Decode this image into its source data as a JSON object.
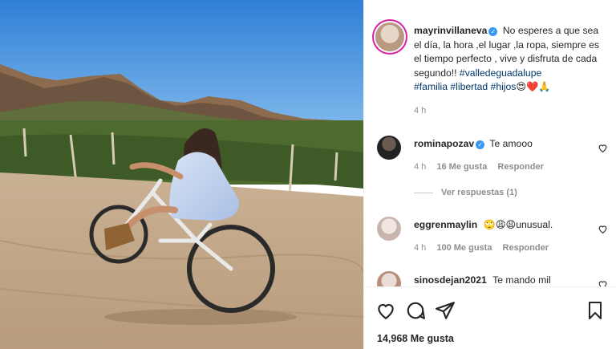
{
  "post": {
    "author": "mayrinvillaneva",
    "caption_text": "No esperes a que sea el día, la hora ,el lugar ,la ropa, siempre es el tiempo perfecto , vive y disfruta de cada segundo!! ",
    "hashtags": [
      "#valledeguadalupe",
      "#familia",
      "#libertad",
      "#hijos"
    ],
    "emojis": [
      "😍",
      "❤️",
      "🙏"
    ],
    "time": "4 h"
  },
  "comments": [
    {
      "user": "rominapozav",
      "verified": true,
      "text": "Te amooo",
      "time": "4 h",
      "likes": "16 Me gusta",
      "reply": "Responder",
      "replies_label": "Ver respuestas (1)"
    },
    {
      "user": "eggrenmaylin",
      "verified": false,
      "text": "🙄😩😩unusual.",
      "time": "4 h",
      "likes": "100 Me gusta",
      "reply": "Responder"
    },
    {
      "user": "sinosdejan2021",
      "verified": false,
      "text": "Te mando mil"
    }
  ],
  "footer": {
    "likes": "14,968 Me gusta"
  },
  "colors": {
    "verified": "#3897f0",
    "hashtag": "#00376b",
    "meta": "#8e8e8e",
    "heart": "#ed4956"
  },
  "icons": [
    "heart-icon",
    "comment-icon",
    "share-icon",
    "bookmark-icon"
  ]
}
